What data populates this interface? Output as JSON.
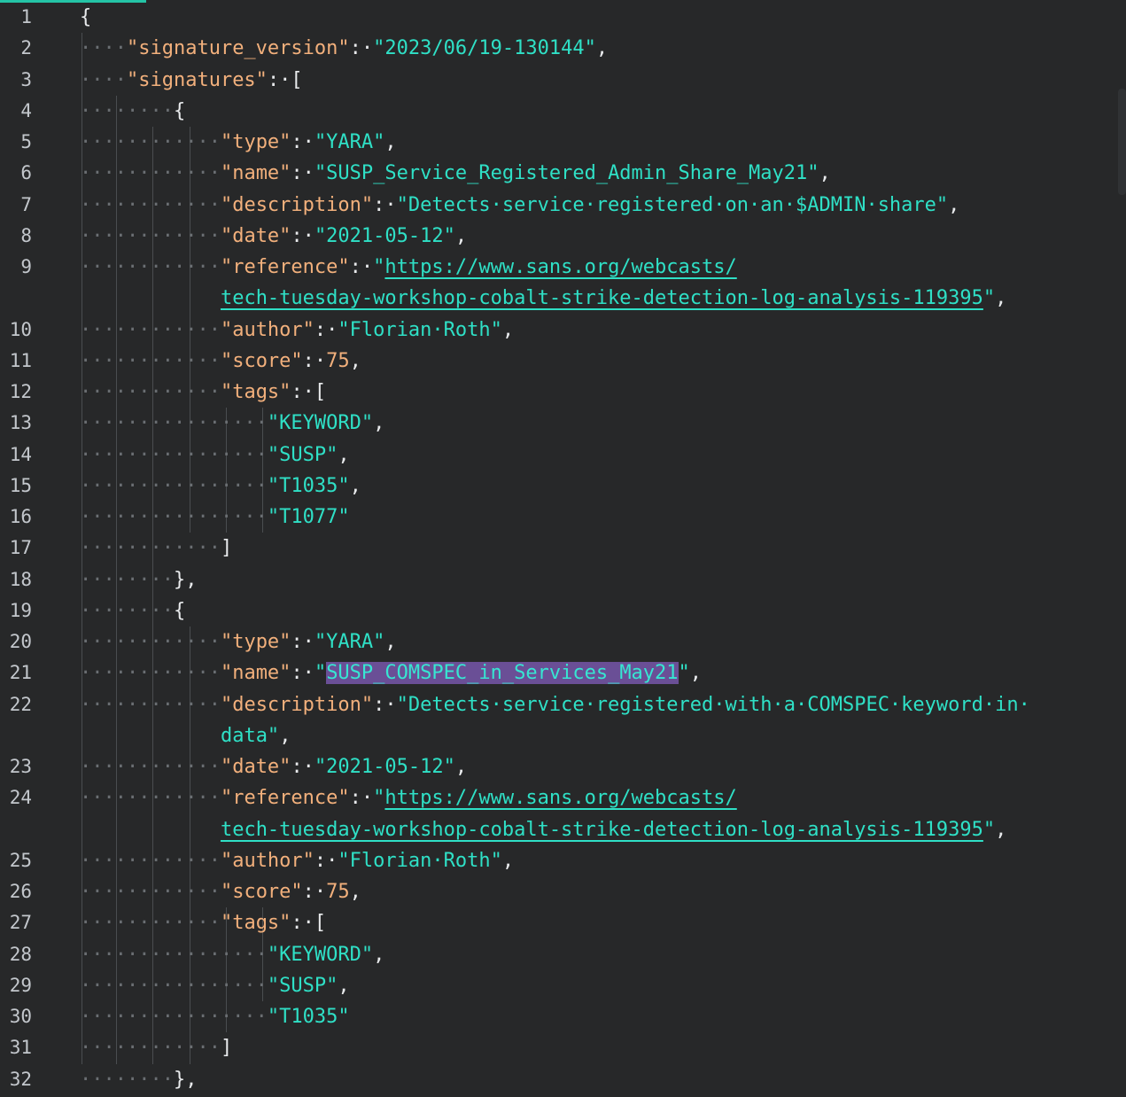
{
  "editor": {
    "lines": [
      {
        "n": "1",
        "toks": [
          [
            "pn",
            "{"
          ]
        ]
      },
      {
        "n": "2",
        "toks": [
          [
            "ws",
            "····"
          ],
          [
            "key",
            "\"signature_version\""
          ],
          [
            "pn",
            ":·"
          ],
          [
            "str",
            "\"2023/06/19-130144\""
          ],
          [
            "pn",
            ","
          ]
        ]
      },
      {
        "n": "3",
        "toks": [
          [
            "ws",
            "····"
          ],
          [
            "key",
            "\"signatures\""
          ],
          [
            "pn",
            ":·["
          ]
        ]
      },
      {
        "n": "4",
        "toks": [
          [
            "ws",
            "········"
          ],
          [
            "pn",
            "{"
          ]
        ]
      },
      {
        "n": "5",
        "toks": [
          [
            "ws",
            "············"
          ],
          [
            "key",
            "\"type\""
          ],
          [
            "pn",
            ":·"
          ],
          [
            "str",
            "\"YARA\""
          ],
          [
            "pn",
            ","
          ]
        ]
      },
      {
        "n": "6",
        "toks": [
          [
            "ws",
            "············"
          ],
          [
            "key",
            "\"name\""
          ],
          [
            "pn",
            ":·"
          ],
          [
            "str",
            "\"SUSP_Service_Registered_Admin_Share_May21\""
          ],
          [
            "pn",
            ","
          ]
        ]
      },
      {
        "n": "7",
        "toks": [
          [
            "ws",
            "············"
          ],
          [
            "key",
            "\"description\""
          ],
          [
            "pn",
            ":·"
          ],
          [
            "str",
            "\"Detects·service·registered·on·an·$ADMIN·share\""
          ],
          [
            "pn",
            ","
          ]
        ]
      },
      {
        "n": "8",
        "toks": [
          [
            "ws",
            "············"
          ],
          [
            "key",
            "\"date\""
          ],
          [
            "pn",
            ":·"
          ],
          [
            "str",
            "\"2021-05-12\""
          ],
          [
            "pn",
            ","
          ]
        ]
      },
      {
        "n": "9",
        "toks": [
          [
            "ws",
            "············"
          ],
          [
            "key",
            "\"reference\""
          ],
          [
            "pn",
            ":·"
          ],
          [
            "str",
            "\""
          ],
          [
            "url",
            "https://www.sans.org/webcasts/"
          ]
        ]
      },
      {
        "n": "",
        "toks": [
          [
            "ws",
            "            "
          ],
          [
            "url",
            "tech-tuesday-workshop-cobalt-strike-detection-log-analysis-119395"
          ],
          [
            "str",
            "\""
          ],
          [
            "pn",
            ","
          ]
        ]
      },
      {
        "n": "10",
        "toks": [
          [
            "ws",
            "············"
          ],
          [
            "key",
            "\"author\""
          ],
          [
            "pn",
            ":·"
          ],
          [
            "str",
            "\"Florian·Roth\""
          ],
          [
            "pn",
            ","
          ]
        ]
      },
      {
        "n": "11",
        "toks": [
          [
            "ws",
            "············"
          ],
          [
            "key",
            "\"score\""
          ],
          [
            "pn",
            ":·"
          ],
          [
            "num",
            "75"
          ],
          [
            "pn",
            ","
          ]
        ]
      },
      {
        "n": "12",
        "toks": [
          [
            "ws",
            "············"
          ],
          [
            "key",
            "\"tags\""
          ],
          [
            "pn",
            ":·["
          ]
        ]
      },
      {
        "n": "13",
        "toks": [
          [
            "ws",
            "················"
          ],
          [
            "str",
            "\"KEYWORD\""
          ],
          [
            "pn",
            ","
          ]
        ]
      },
      {
        "n": "14",
        "toks": [
          [
            "ws",
            "················"
          ],
          [
            "str",
            "\"SUSP\""
          ],
          [
            "pn",
            ","
          ]
        ]
      },
      {
        "n": "15",
        "toks": [
          [
            "ws",
            "················"
          ],
          [
            "str",
            "\"T1035\""
          ],
          [
            "pn",
            ","
          ]
        ]
      },
      {
        "n": "16",
        "toks": [
          [
            "ws",
            "················"
          ],
          [
            "str",
            "\"T1077\""
          ]
        ]
      },
      {
        "n": "17",
        "toks": [
          [
            "ws",
            "············"
          ],
          [
            "pn",
            "]"
          ]
        ]
      },
      {
        "n": "18",
        "toks": [
          [
            "ws",
            "········"
          ],
          [
            "pn",
            "},"
          ]
        ]
      },
      {
        "n": "19",
        "toks": [
          [
            "ws",
            "········"
          ],
          [
            "pn",
            "{"
          ]
        ]
      },
      {
        "n": "20",
        "toks": [
          [
            "ws",
            "············"
          ],
          [
            "key",
            "\"type\""
          ],
          [
            "pn",
            ":·"
          ],
          [
            "str",
            "\"YARA\""
          ],
          [
            "pn",
            ","
          ]
        ]
      },
      {
        "n": "21",
        "toks": [
          [
            "ws",
            "············"
          ],
          [
            "key",
            "\"name\""
          ],
          [
            "pn",
            ":·"
          ],
          [
            "str",
            "\""
          ],
          [
            "sel",
            "SUSP_COMSPEC_in_Services_May21"
          ],
          [
            "str",
            "\""
          ],
          [
            "pn",
            ","
          ]
        ]
      },
      {
        "n": "22",
        "toks": [
          [
            "ws",
            "············"
          ],
          [
            "key",
            "\"description\""
          ],
          [
            "pn",
            ":·"
          ],
          [
            "str",
            "\"Detects·service·registered·with·a·COMSPEC·keyword·in·"
          ]
        ]
      },
      {
        "n": "",
        "toks": [
          [
            "ws",
            "            "
          ],
          [
            "str",
            "data\""
          ],
          [
            "pn",
            ","
          ]
        ]
      },
      {
        "n": "23",
        "toks": [
          [
            "ws",
            "············"
          ],
          [
            "key",
            "\"date\""
          ],
          [
            "pn",
            ":·"
          ],
          [
            "str",
            "\"2021-05-12\""
          ],
          [
            "pn",
            ","
          ]
        ]
      },
      {
        "n": "24",
        "toks": [
          [
            "ws",
            "············"
          ],
          [
            "key",
            "\"reference\""
          ],
          [
            "pn",
            ":·"
          ],
          [
            "str",
            "\""
          ],
          [
            "url",
            "https://www.sans.org/webcasts/"
          ]
        ]
      },
      {
        "n": "",
        "toks": [
          [
            "ws",
            "            "
          ],
          [
            "url",
            "tech-tuesday-workshop-cobalt-strike-detection-log-analysis-119395"
          ],
          [
            "str",
            "\""
          ],
          [
            "pn",
            ","
          ]
        ]
      },
      {
        "n": "25",
        "toks": [
          [
            "ws",
            "············"
          ],
          [
            "key",
            "\"author\""
          ],
          [
            "pn",
            ":·"
          ],
          [
            "str",
            "\"Florian·Roth\""
          ],
          [
            "pn",
            ","
          ]
        ]
      },
      {
        "n": "26",
        "toks": [
          [
            "ws",
            "············"
          ],
          [
            "key",
            "\"score\""
          ],
          [
            "pn",
            ":·"
          ],
          [
            "num",
            "75"
          ],
          [
            "pn",
            ","
          ]
        ]
      },
      {
        "n": "27",
        "toks": [
          [
            "ws",
            "············"
          ],
          [
            "key",
            "\"tags\""
          ],
          [
            "pn",
            ":·["
          ]
        ]
      },
      {
        "n": "28",
        "toks": [
          [
            "ws",
            "················"
          ],
          [
            "str",
            "\"KEYWORD\""
          ],
          [
            "pn",
            ","
          ]
        ]
      },
      {
        "n": "29",
        "toks": [
          [
            "ws",
            "················"
          ],
          [
            "str",
            "\"SUSP\""
          ],
          [
            "pn",
            ","
          ]
        ]
      },
      {
        "n": "30",
        "toks": [
          [
            "ws",
            "················"
          ],
          [
            "str",
            "\"T1035\""
          ]
        ]
      },
      {
        "n": "31",
        "toks": [
          [
            "ws",
            "············"
          ],
          [
            "pn",
            "]"
          ]
        ]
      },
      {
        "n": "32",
        "toks": [
          [
            "ws",
            "········"
          ],
          [
            "pn",
            "},"
          ]
        ]
      }
    ]
  },
  "colors": {
    "background": "#272829",
    "key": "#f2b07c",
    "string": "#2fe0c6",
    "selection": "#6a4f96"
  }
}
